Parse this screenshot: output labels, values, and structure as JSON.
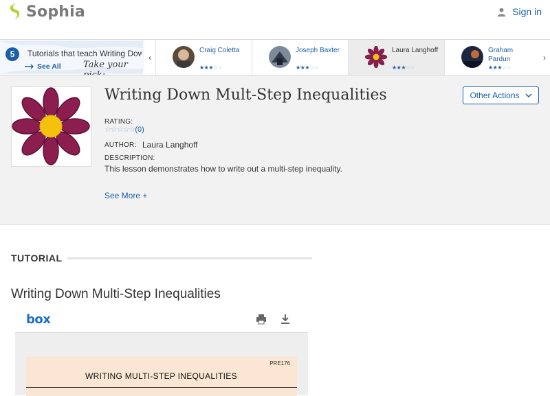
{
  "header": {
    "brand": "Sophia",
    "signin_label": "Sign in"
  },
  "strip": {
    "count": "5",
    "title": "Tutorials that teach Writing Dow",
    "see_all": "See All",
    "pick": "Take your pick:",
    "tutors": [
      {
        "name": "Craig Coletta",
        "stars": 3
      },
      {
        "name": "Joseph Baxter",
        "stars": 3
      },
      {
        "name": "Laura Langhoff",
        "stars": 3,
        "active": true
      },
      {
        "name": "Graham\nPardun",
        "stars": 3
      }
    ]
  },
  "info": {
    "title": "Writing Down Mult-Step Inequalities",
    "other_actions": "Other Actions",
    "rating_label": "RATING:",
    "rating_count": "(0)",
    "author_label": "AUTHOR:",
    "author": "Laura Langhoff",
    "description_label": "DESCRIPTION:",
    "description": "This lesson demonstrates how to write out a multi-step inequality.",
    "see_more": "See More +"
  },
  "tutorial": {
    "section_label": "TUTORIAL",
    "title": "Writing Down Multi-Step Inequalities"
  },
  "viewer": {
    "brand": "box",
    "doc_code": "PRE176",
    "doc_heading": "WRITING MULTI-STEP INEQUALITIES"
  },
  "colors": {
    "brand_green": "#b5cf34",
    "link_blue": "#1a5fa8",
    "flower_petal": "#8b1d4f",
    "flower_center": "#f4c20d"
  }
}
